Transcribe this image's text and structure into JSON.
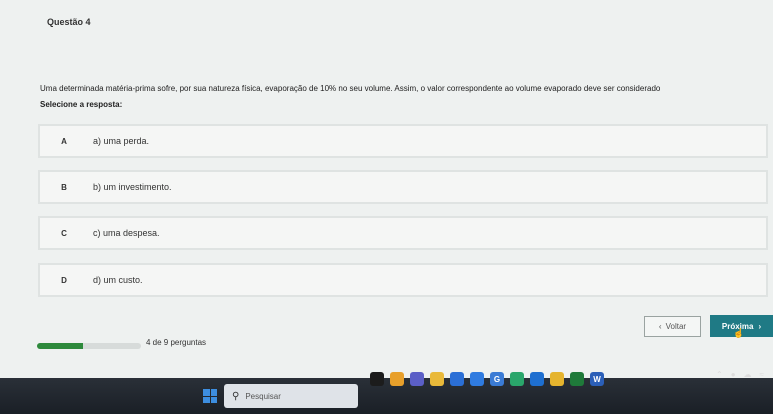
{
  "question": {
    "title": "Questão 4",
    "prompt": "Uma determinada matéria-prima sofre, por sua natureza física, evaporação de 10% no seu volume. Assim, o valor correspondente ao volume evaporado deve ser considerado",
    "select_label": "Selecione a resposta:"
  },
  "options": [
    {
      "letter": "A",
      "text": "a) uma perda."
    },
    {
      "letter": "B",
      "text": "b) um investimento."
    },
    {
      "letter": "C",
      "text": "c) uma despesa."
    },
    {
      "letter": "D",
      "text": "d) um custo."
    }
  ],
  "progress": {
    "text": "4 de 9 perguntas",
    "current": 4,
    "total": 9,
    "color": "#2e8a3c"
  },
  "nav": {
    "back_icon": "‹",
    "back_label": "Voltar",
    "next_label": "Próxima",
    "next_icon": "›",
    "next_color": "#1f7a85"
  },
  "taskbar": {
    "search_placeholder": "Pesquisar",
    "apps": [
      {
        "name": "task-view-icon",
        "color": "#1c1c1c",
        "glyph": ""
      },
      {
        "name": "widget-icon",
        "color": "#e8a02b",
        "glyph": ""
      },
      {
        "name": "teams-icon",
        "color": "#5b5fc7",
        "glyph": ""
      },
      {
        "name": "file-explorer-icon",
        "color": "#e9b93a",
        "glyph": ""
      },
      {
        "name": "store-icon",
        "color": "#2b6fd6",
        "glyph": ""
      },
      {
        "name": "chrome-icon",
        "color": "#2f7be0",
        "glyph": ""
      },
      {
        "name": "google-icon",
        "color": "#3a7bd5",
        "glyph": "G"
      },
      {
        "name": "edge-icon",
        "color": "#2aa66b",
        "glyph": ""
      },
      {
        "name": "edge-beta-icon",
        "color": "#1e6fd0",
        "glyph": ""
      },
      {
        "name": "chrome-canary-icon",
        "color": "#e5b42e",
        "glyph": ""
      },
      {
        "name": "excel-icon",
        "color": "#1f7a3a",
        "glyph": ""
      },
      {
        "name": "word-icon",
        "color": "#2b5fb8",
        "glyph": "W"
      }
    ]
  }
}
